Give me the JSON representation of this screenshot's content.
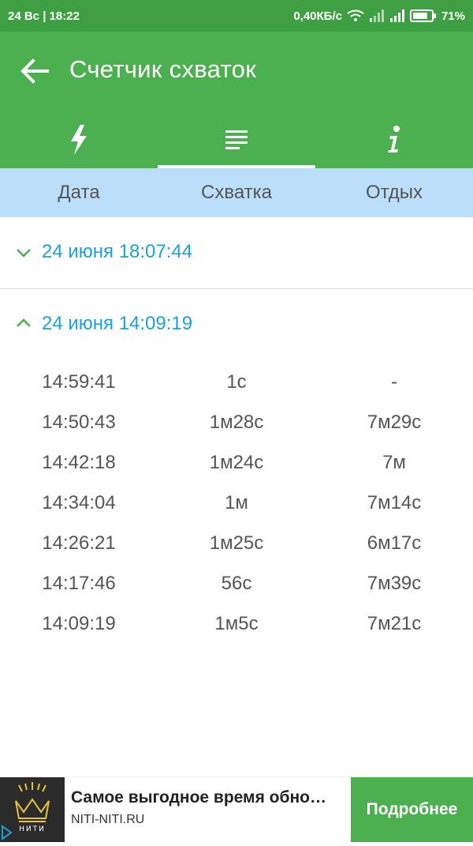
{
  "status_bar": {
    "left_text": "24 Вс | 18:22",
    "speed": "0,40КБ/с",
    "battery": "71%"
  },
  "app_bar": {
    "title": "Счетчик схваток",
    "tabs": [
      {
        "icon": "lightning-icon",
        "active": false
      },
      {
        "icon": "list-icon",
        "active": true
      },
      {
        "icon": "info-icon",
        "active": false
      }
    ]
  },
  "columns": [
    "Дата",
    "Схватка",
    "Отдых"
  ],
  "sessions": [
    {
      "label": "24 июня 18:07:44",
      "expanded": false
    },
    {
      "label": "24 июня 14:09:19",
      "expanded": true
    }
  ],
  "rows": [
    {
      "time": "14:59:41",
      "contraction": "1с",
      "rest": "-"
    },
    {
      "time": "14:50:43",
      "contraction": "1м28с",
      "rest": "7м29с"
    },
    {
      "time": "14:42:18",
      "contraction": "1м24с",
      "rest": "7м"
    },
    {
      "time": "14:34:04",
      "contraction": "1м",
      "rest": "7м14с"
    },
    {
      "time": "14:26:21",
      "contraction": "1м25с",
      "rest": "6м17с"
    },
    {
      "time": "14:17:46",
      "contraction": "56с",
      "rest": "7м39с"
    },
    {
      "time": "14:09:19",
      "contraction": "1м5с",
      "rest": "7м21с"
    }
  ],
  "ad": {
    "title": "Самое выгодное время обно…",
    "url": "NITI-NITI.RU",
    "button": "Подробнее",
    "logo_text": "НИТИ"
  },
  "colors": {
    "status_bar": "#3e9f43",
    "app_bar": "#4caf50",
    "header_bg": "#bbdefb",
    "session_label": "#1aa3d4"
  }
}
